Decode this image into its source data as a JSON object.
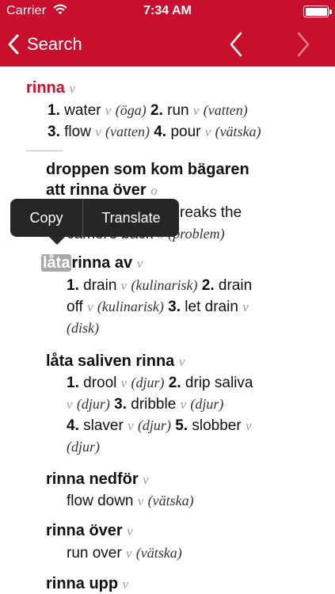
{
  "status_bar": {
    "carrier": "Carrier",
    "time": "7:34 AM"
  },
  "nav": {
    "back_label": "Search"
  },
  "entries": [
    {
      "headword": "rinna",
      "pos": "v",
      "senses": [
        {
          "num": "1.",
          "word": "water",
          "pos": "v",
          "ctx": "(öga)"
        },
        {
          "num": "2.",
          "word": "run",
          "pos": "v",
          "ctx": "(vatten)"
        },
        {
          "num": "3.",
          "word": "flow",
          "pos": "v",
          "ctx": "(vatten)"
        },
        {
          "num": "4.",
          "word": "pour",
          "pos": "v",
          "ctx": "(vätska)"
        }
      ]
    },
    {
      "headword_line1": "droppen som kom bägaren",
      "headword_line2": "att rinna över",
      "pos": "o",
      "translation_visible": "reaks the",
      "translation_line2": "camel's back",
      "translation_pos": "o",
      "translation_ctx": "(problem)"
    },
    {
      "selected_word": "låta",
      "headword_rest": "rinna av",
      "pos": "v",
      "senses": [
        {
          "num": "1.",
          "word": "drain",
          "pos": "v",
          "ctx": "(kulinarisk)"
        },
        {
          "num": "2.",
          "word": "drain off",
          "pos": "v",
          "ctx": "(kulinarisk)"
        },
        {
          "num": "3.",
          "word": "let drain",
          "pos": "v",
          "ctx": "(disk)"
        }
      ]
    },
    {
      "headword": "låta saliven rinna",
      "pos": "v",
      "senses": [
        {
          "num": "1.",
          "word": "drool",
          "pos": "v",
          "ctx": "(djur)"
        },
        {
          "num": "2.",
          "word": "drip saliva",
          "pos": "v",
          "ctx": "(djur)"
        },
        {
          "num": "3.",
          "word": "dribble",
          "pos": "v",
          "ctx": "(djur)"
        },
        {
          "num": "4.",
          "word": "slaver",
          "pos": "v",
          "ctx": "(djur)"
        },
        {
          "num": "5.",
          "word": "slobber",
          "pos": "v",
          "ctx": "(djur)"
        }
      ]
    },
    {
      "headword": "rinna nedför",
      "pos": "v",
      "translation": "flow down",
      "translation_pos": "v",
      "translation_ctx": "(vätska)"
    },
    {
      "headword": "rinna över",
      "pos": "v",
      "translation": "run over",
      "translation_pos": "v",
      "translation_ctx": "(vätska)"
    },
    {
      "headword": "rinna upp",
      "pos": "v"
    }
  ],
  "popup": {
    "copy": "Copy",
    "translate": "Translate"
  },
  "colors": {
    "accent": "#c8102e",
    "popup_bg": "#262626"
  }
}
